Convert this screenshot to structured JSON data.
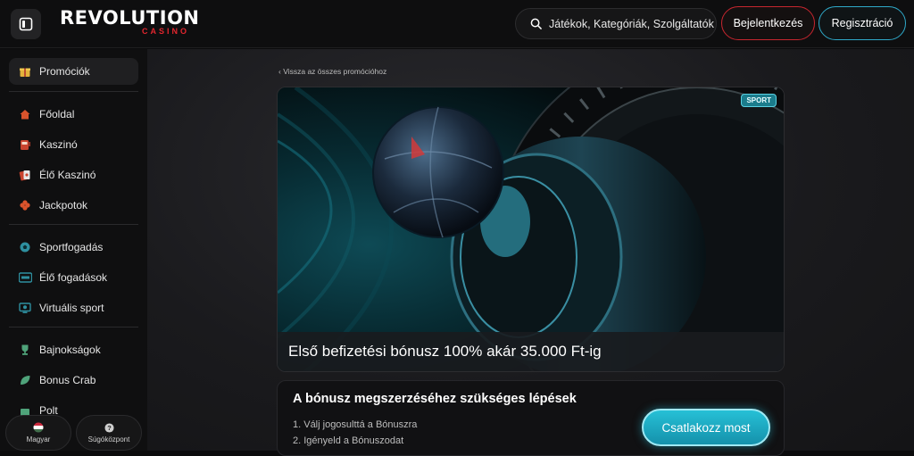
{
  "header": {
    "logo_text": "REVOLUTION",
    "logo_sub": "CASINO",
    "search_placeholder": "Játékok, Kategóriák, Szolgáltatók",
    "login_label": "Bejelentkezés",
    "register_label": "Regisztráció"
  },
  "sidebar": {
    "items": [
      {
        "label": "Promóciók",
        "icon": "gift-icon",
        "active": true
      },
      {
        "label": "Főoldal",
        "icon": "home-icon"
      },
      {
        "label": "Kaszinó",
        "icon": "slot-machine-icon"
      },
      {
        "label": "Élő Kaszinó",
        "icon": "cards-icon"
      },
      {
        "label": "Jackpotok",
        "icon": "clover-icon"
      },
      {
        "label": "Sportfogadás",
        "icon": "soccer-ball-icon"
      },
      {
        "label": "Élő fogadások",
        "icon": "live-icon"
      },
      {
        "label": "Virtuális sport",
        "icon": "screen-icon"
      },
      {
        "label": "Bajnokságok",
        "icon": "trophy-icon"
      },
      {
        "label": "Bonus Crab",
        "icon": "leaf-icon"
      },
      {
        "label": "Polt",
        "icon": "shop-icon"
      }
    ],
    "language_label": "Magyar",
    "help_label": "Súgóközpont"
  },
  "main": {
    "back_link": "Vissza az összes promócióhoz",
    "badge": "SPORT",
    "banner_title": "Első befizetési bónusz 100% akár 35.000 Ft-ig",
    "steps_title": "A bónusz megszerzéséhez szükséges lépések",
    "steps": [
      "1. Válj jogosulttá a Bónuszra",
      "2. Igényeld a Bónuszodat"
    ],
    "cta_label": "Csatlakozz most"
  },
  "colors": {
    "accent_red": "#e3262e",
    "accent_cyan": "#26c0d6",
    "background": "#0b0b0c"
  }
}
